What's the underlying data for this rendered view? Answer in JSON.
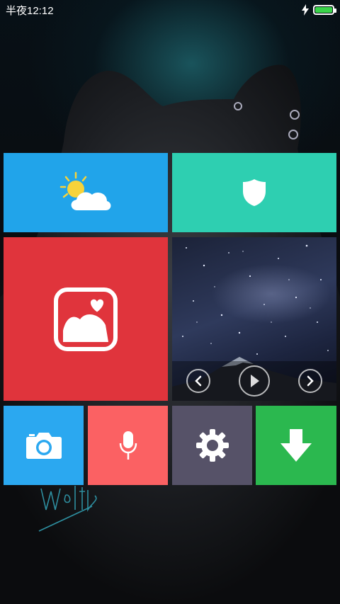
{
  "status_bar": {
    "time": "半夜12:12",
    "charging_icon": "bolt-icon",
    "battery_icon": "battery-icon",
    "battery_level": 1.0,
    "battery_color": "#3ad44a"
  },
  "tiles": [
    {
      "name": "weather",
      "icon": "weather-sun-cloud-icon",
      "color": "#21a4ea"
    },
    {
      "name": "security",
      "icon": "shield-icon",
      "color": "#2ecfb1"
    },
    {
      "name": "gallery",
      "icon": "gallery-heart-icon",
      "color": "#e0343c"
    },
    {
      "name": "photo-slideshow",
      "icon": "starry-sky-image"
    },
    {
      "name": "camera",
      "icon": "camera-icon",
      "color": "#2ba8f0"
    },
    {
      "name": "voice",
      "icon": "microphone-icon",
      "color": "#fb6163"
    },
    {
      "name": "settings",
      "icon": "gear-icon",
      "color": "#565268"
    },
    {
      "name": "download",
      "icon": "download-arrow-icon",
      "color": "#2bb84f"
    }
  ],
  "photo_controls": {
    "prev_icon": "chevron-left-icon",
    "play_icon": "play-icon",
    "next_icon": "chevron-right-icon"
  }
}
